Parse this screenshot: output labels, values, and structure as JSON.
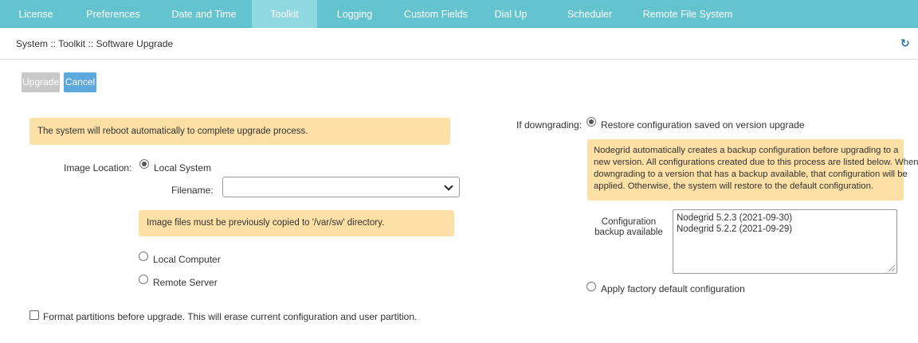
{
  "nav": {
    "tabs": [
      {
        "label": "License"
      },
      {
        "label": "Preferences"
      },
      {
        "label": "Date and Time"
      },
      {
        "label": "Toolkit"
      },
      {
        "label": "Logging"
      },
      {
        "label": "Custom Fields"
      },
      {
        "label": "Dial Up"
      },
      {
        "label": "Scheduler"
      },
      {
        "label": "Remote File System"
      }
    ],
    "active_tab": "Toolkit"
  },
  "breadcrumb": "System :: Toolkit :: Software Upgrade",
  "buttons": {
    "upgrade": "Upgrade",
    "cancel": "Cancel"
  },
  "left": {
    "reboot_note": "The system will reboot automatically to complete upgrade process.",
    "image_location_label": "Image Location:",
    "options": {
      "local_system": "Local System",
      "local_computer": "Local Computer",
      "remote_server": "Remote Server"
    },
    "selected_option": "Local System",
    "filename_label": "Filename:",
    "filename_value": "",
    "image_note": "Image files must be previously copied to '/var/sw' directory.",
    "format_checkbox": "Format partitions before upgrade. This will erase current configuration and user partition.",
    "format_checked": false
  },
  "right": {
    "downgrade_label": "If downgrading:",
    "restore_option": "Restore configuration saved on version upgrade",
    "restore_selected": true,
    "backup_note_lines": [
      "Nodegrid automatically creates a backup configuration before upgrading to a",
      "new version. All configurations created due to this process are listed below. When",
      "downgrading to a version that has a backup available, that configuration will be",
      "applied. Otherwise, the system will restore to the default configuration."
    ],
    "backup_label_line1": "Configuration",
    "backup_label_line2": "backup available",
    "backups": [
      "Nodegrid 5.2.3 (2021-09-30)",
      "Nodegrid 5.2.2 (2021-09-29)"
    ],
    "factory_option": "Apply factory default configuration"
  },
  "colors": {
    "nav_bg": "#63c3cf",
    "nav_active": "#8fd8e1",
    "note_bg": "#fde0a6",
    "cancel_btn": "#5da8dc",
    "upgrade_btn_disabled": "#c8c8c8"
  },
  "icons": {
    "refresh": "refresh-icon",
    "dropdown": "chevron-down-icon"
  }
}
